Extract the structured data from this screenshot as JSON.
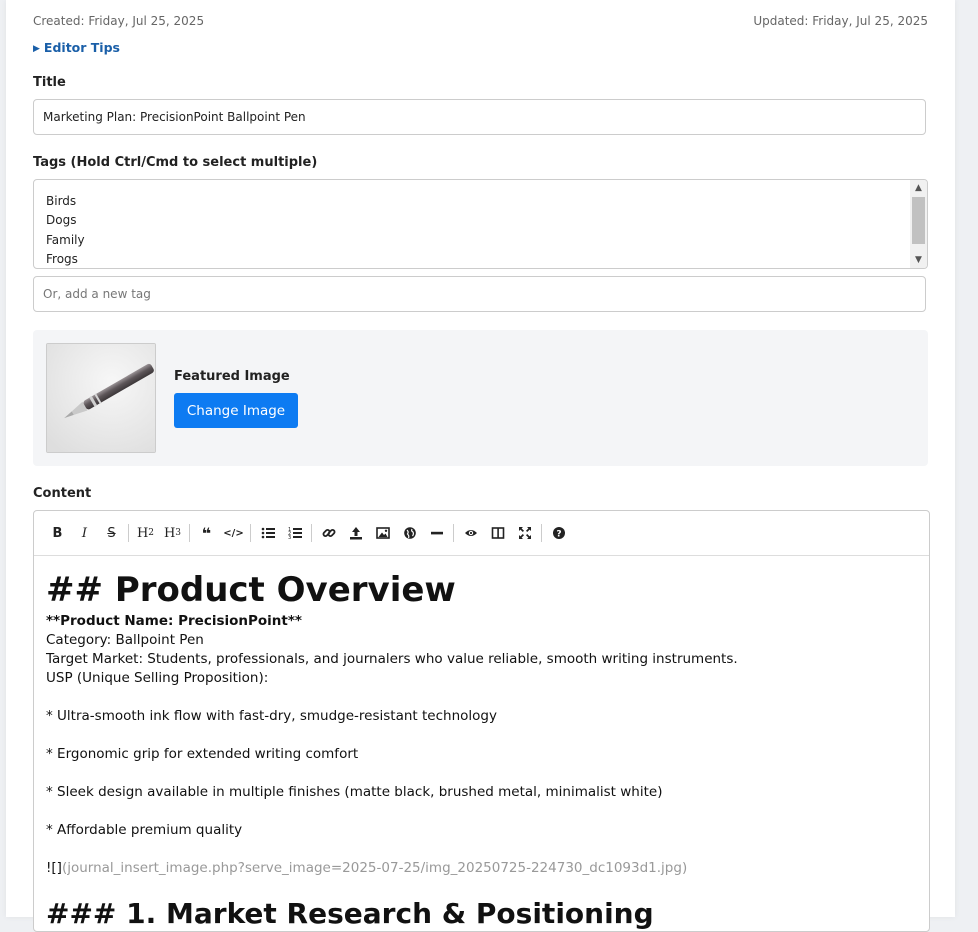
{
  "meta": {
    "created": "Created: Friday, Jul 25, 2025",
    "updated": "Updated: Friday, Jul 25, 2025"
  },
  "editor_tips": "Editor Tips",
  "title_field": {
    "label": "Title",
    "value": "Marketing Plan: PrecisionPoint Ballpoint Pen"
  },
  "tags": {
    "label": "Tags (Hold Ctrl/Cmd to select multiple)",
    "options": [
      "Birds",
      "Dogs",
      "Family",
      "Frogs"
    ],
    "new_tag_placeholder": "Or, add a new tag"
  },
  "featured_image": {
    "label": "Featured Image",
    "button": "Change Image"
  },
  "content": {
    "label": "Content",
    "toolbar_icons": [
      "bold-icon",
      "italic-icon",
      "strikethrough-icon",
      "heading-2-icon",
      "heading-3-icon",
      "quote-icon",
      "code-icon",
      "unordered-list-icon",
      "ordered-list-icon",
      "link-icon",
      "upload-icon",
      "image-icon",
      "globe-icon",
      "horizontal-rule-icon",
      "preview-icon",
      "side-by-side-icon",
      "fullscreen-icon",
      "help-icon"
    ],
    "h2": "## Product Overview",
    "product_name": "**Product Name: PrecisionPoint**",
    "category": "Category: Ballpoint Pen",
    "target_market": "Target Market: Students, professionals, and journalers who value reliable, smooth writing instruments.",
    "usp": "USP (Unique Selling Proposition):",
    "bullet1": "* Ultra-smooth ink flow with fast-dry, smudge-resistant technology",
    "bullet2": "* Ergonomic grip for extended writing comfort",
    "bullet3": "* Sleek design available in multiple finishes (matte black, brushed metal, minimalist white)",
    "bullet4": "* Affordable premium quality",
    "image_prefix": "![]",
    "image_link": "(journal_insert_image.php?serve_image=2025-07-25/img_20250725-224730_dc1093d1.jpg)",
    "h3": "### 1. Market Research & Positioning"
  },
  "colors": {
    "accent": "#0d7bf2",
    "link": "#1a5fa8"
  }
}
